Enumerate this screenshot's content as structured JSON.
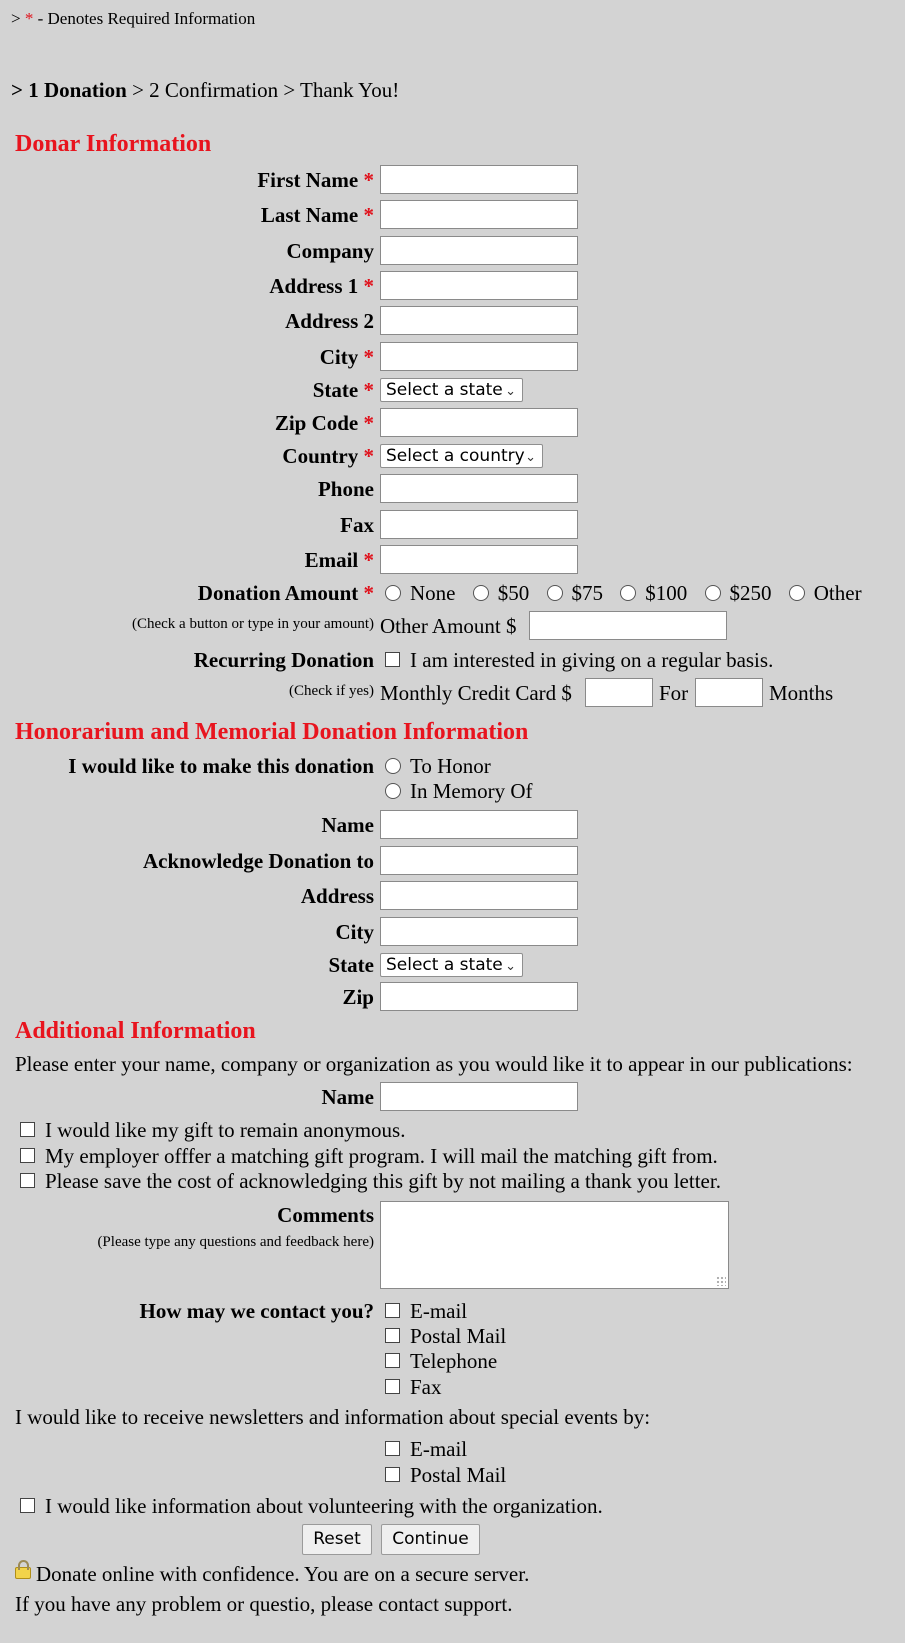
{
  "header": {
    "req_prefix": ">",
    "req_star": "*",
    "req_text": "- Denotes Required Information",
    "steps_prefix": ">",
    "step1": "1 Donation",
    "step2": "> 2 Confirmation > Thank You!"
  },
  "required_marker": "*",
  "donor": {
    "title": "Donar Information",
    "fields": {
      "first_name": "First Name",
      "last_name": "Last Name",
      "company": "Company",
      "address1": "Address 1",
      "address2": "Address 2",
      "city": "City",
      "state": "State",
      "zip": "Zip Code",
      "country": "Country",
      "phone": "Phone",
      "fax": "Fax",
      "email": "Email"
    },
    "state_select": "Select a state",
    "country_select": "Select a country",
    "donation_amount_label": "Donation Amount",
    "amount_options": [
      "None",
      "$50",
      "$75",
      "$100",
      "$250",
      "Other"
    ],
    "amount_hint": "(Check a button or type in your amount)",
    "other_amount_label": "Other Amount $",
    "recurring_label": "Recurring Donation",
    "recurring_check": "I am interested in giving on a regular basis.",
    "recurring_hint": "(Check if yes)",
    "monthly_label": "Monthly Credit Card $",
    "for_label": "For",
    "months_label": "Months"
  },
  "honor": {
    "title": "Honorarium and Memorial Donation Information",
    "make_label": "I would like to make this donation",
    "option_honor": "To Honor",
    "option_memory": "In Memory Of",
    "name": "Name",
    "acknowledge": "Acknowledge Donation to",
    "address": "Address",
    "city": "City",
    "state": "State",
    "state_select": "Select a state",
    "zip": "Zip"
  },
  "additional": {
    "title": "Additional Information",
    "intro": "Please enter your name, company or organization as you would like it to appear in our publications:",
    "name": "Name",
    "anonymous": "I would like my gift to remain anonymous.",
    "employer": "My employer offfer a matching gift program. I will mail the matching gift from.",
    "no_letter": "Please save the cost of acknowledging this gift by not mailing a thank you letter.",
    "comments_label": "Comments",
    "comments_hint": "(Please type any questions and feedback here)",
    "contact_label": "How may we contact you?",
    "contact_options": [
      "E-mail",
      "Postal Mail",
      "Telephone",
      "Fax"
    ],
    "newsletter_text": "I would like to receive newsletters and information about special events by:",
    "newsletter_options": [
      "E-mail",
      "Postal Mail"
    ],
    "volunteer": "I would like information about volunteering with the organization."
  },
  "buttons": {
    "reset": "Reset",
    "continue": "Continue"
  },
  "footer": {
    "secure": "Donate online with confidence. You are on a secure server.",
    "support": "If you have any problem or questio, please contact support."
  },
  "icons": {
    "lock": "lock-icon",
    "chevron": "chevron-down-icon"
  }
}
